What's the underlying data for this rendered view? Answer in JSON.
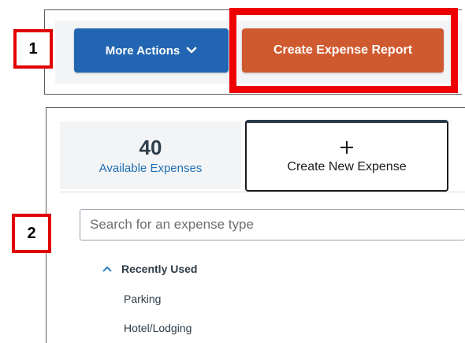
{
  "steps": {
    "step1_label": "1",
    "step2_label": "2"
  },
  "toolbar": {
    "more_actions_label": "More Actions",
    "more_actions_icon": "chevron-down-icon",
    "create_report_label": "Create Expense Report"
  },
  "tabs": {
    "available": {
      "count": "40",
      "label": "Available Expenses"
    },
    "create": {
      "icon": "plus-icon",
      "label": "Create New Expense"
    }
  },
  "search": {
    "placeholder": "Search for an expense type"
  },
  "recently_used": {
    "title": "Recently Used",
    "items": [
      {
        "label": "Parking"
      },
      {
        "label": "Hotel/Lodging"
      }
    ]
  },
  "colors": {
    "highlight_red": "#ee0000",
    "more_actions_blue": "#2266b3",
    "create_report_orange": "#d05a2f",
    "link_blue": "#1f6fb8"
  }
}
